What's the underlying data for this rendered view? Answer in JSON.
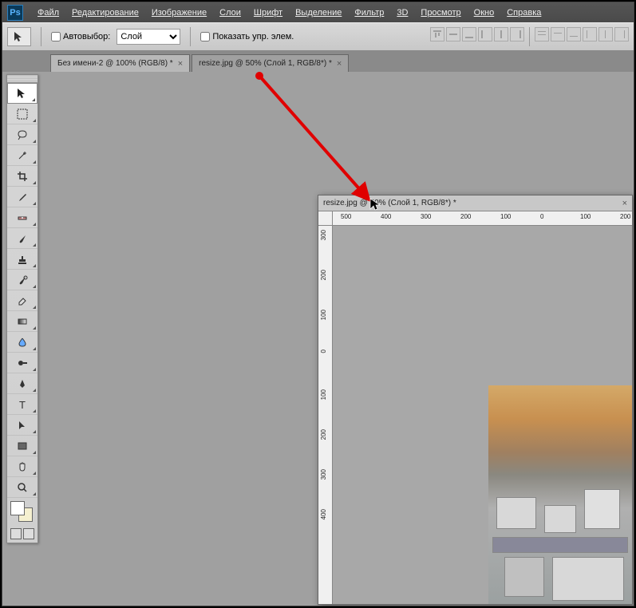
{
  "menu": {
    "items": [
      "Файл",
      "Редактирование",
      "Изображение",
      "Слои",
      "Шрифт",
      "Выделение",
      "Фильтр",
      "3D",
      "Просмотр",
      "Окно",
      "Справка"
    ]
  },
  "options": {
    "autoselect_label": "Автовыбор:",
    "layer_select": "Слой",
    "show_controls_label": "Показать упр. элем."
  },
  "tabs": [
    {
      "label": "Без имени-2 @ 100% (RGB/8) *"
    },
    {
      "label": "resize.jpg @ 50% (Слой 1, RGB/8*) *"
    }
  ],
  "float_window": {
    "title": "resize.jpg @ 50% (Слой 1, RGB/8*) *"
  },
  "h_ruler_ticks": [
    "500",
    "400",
    "300",
    "200",
    "100",
    "0",
    "100",
    "200"
  ],
  "v_ruler_ticks": [
    "300",
    "200",
    "100",
    "0",
    "100",
    "200",
    "300",
    "400"
  ],
  "tools": [
    "move-tool",
    "marquee-tool",
    "lasso-tool",
    "wand-tool",
    "crop-tool",
    "eyedropper-tool",
    "healing-tool",
    "brush-tool",
    "stamp-tool",
    "history-brush-tool",
    "eraser-tool",
    "gradient-tool",
    "blur-tool",
    "dodge-tool",
    "pen-tool",
    "type-tool",
    "path-select-tool",
    "rectangle-tool",
    "hand-tool",
    "zoom-tool"
  ]
}
